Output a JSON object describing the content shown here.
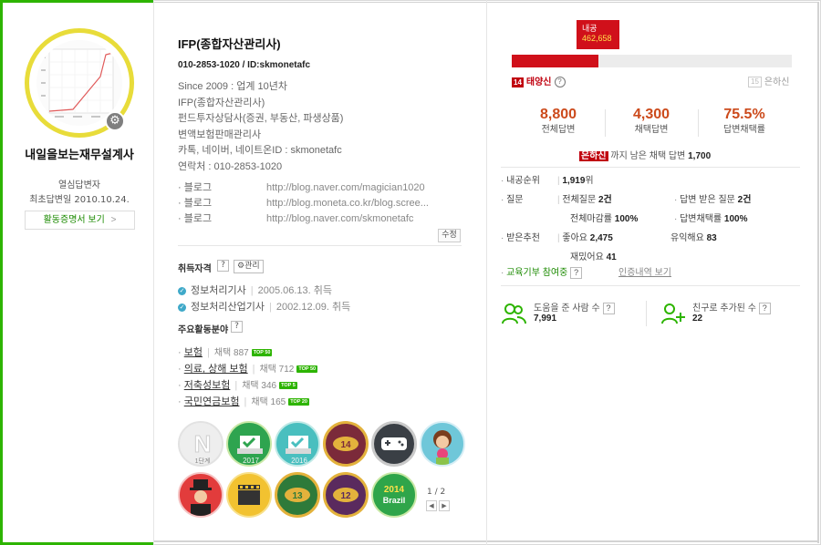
{
  "profile": {
    "nickname": "내일을보는재무설계사",
    "rank": "열심답변자",
    "first_answer": "최초답변일 2010.10.24.",
    "activity_button": "활동증명서 보기",
    "activity_arrow": ">"
  },
  "intro": {
    "title": "IFP(종합자산관리사)",
    "phone_id": "010-2853-1020 / ID:skmonetafc",
    "lines": [
      "Since 2009 : 업계 10년차",
      "IFP(종합자산관리사)",
      "펀드투자상담사(증권, 부동산, 파생상품)",
      "변액보험판매관리사",
      "카톡, 네이버, 네이트온ID : skmonetafc",
      "연락처 : 010-2853-1020"
    ]
  },
  "blogs": [
    {
      "label": "· 블로그",
      "url": "http://blog.naver.com/magician1020"
    },
    {
      "label": "· 블로그",
      "url": "http://blog.moneta.co.kr/blog.scree..."
    },
    {
      "label": "· 블로그",
      "url": "http://blog.naver.com/skmonetafc"
    }
  ],
  "edit_label": "수정",
  "certificates": {
    "heading": "취득자격",
    "help": "?",
    "manage_label": "⚙관리",
    "items": [
      {
        "name": "정보처리기사",
        "date": "2005.06.13. 취득"
      },
      {
        "name": "정보처리산업기사",
        "date": "2002.12.09. 취득"
      }
    ]
  },
  "fields": {
    "heading": "주요활동분야",
    "help": "?",
    "items": [
      {
        "name": "보험",
        "count": "채택 887",
        "badge": "TOP 50"
      },
      {
        "name": "의료, 상해 보험",
        "count": "채택 712",
        "badge": "TOP 50"
      },
      {
        "name": "저축성보험",
        "count": "채택 346",
        "badge": "TOP 5"
      },
      {
        "name": "국민연금보험",
        "count": "채택 165",
        "badge": "TOP 20"
      }
    ]
  },
  "badges": {
    "items": [
      {
        "name": "1단계 N"
      },
      {
        "name": "2017"
      },
      {
        "name": "2016"
      },
      {
        "name": "14"
      },
      {
        "name": "game"
      },
      {
        "name": "rose"
      },
      {
        "name": "gentleman"
      },
      {
        "name": "movie"
      },
      {
        "name": "13"
      },
      {
        "name": "12"
      },
      {
        "name": "2014 Brazil"
      }
    ],
    "label_1": "1단계",
    "label_2017": "2017",
    "label_2016": "2016",
    "label_14": "14",
    "label_13": "13",
    "label_12": "12",
    "label_brazil_year": "2014",
    "label_brazil": "Brazil",
    "pager": "1 / 2",
    "prev": "◀",
    "next": "▶"
  },
  "level": {
    "naegong_label": "내공",
    "naegong_value": "462,658",
    "progress_fraction": 0.31,
    "current_num": "14",
    "current_name": "태양신",
    "help": "?",
    "next_num": "15",
    "next_name": "은하신",
    "remain_level": "은하신",
    "remain_text": " 까지 남은 채택 답변 ",
    "remain_count": "1,700"
  },
  "stats": [
    {
      "value": "8,800",
      "label": "전체답변"
    },
    {
      "value": "4,300",
      "label": "채택답변"
    },
    {
      "value": "75.5%",
      "label": "답변채택률"
    }
  ],
  "info": {
    "rank_label": "내공순위",
    "rank_value": "1,919",
    "rank_unit": "위",
    "question_label": "질문",
    "total_q_label": "전체질문",
    "total_q_value": "2건",
    "received_q_label": "답변 받은 질문",
    "received_q_value": "2건",
    "closing_label": "전체마감률",
    "closing_value": "100%",
    "adoption_label": "답변채택률",
    "adoption_value": "100%",
    "rec_label": "받은추천",
    "like_label": "좋아요",
    "like_value": "2,475",
    "useful_label": "유익해요",
    "useful_value": "83",
    "fun_label": "재밌어요",
    "fun_value": "41",
    "donation_label": "교육기부 참여중",
    "donation_help": "?",
    "cert_link": "인증내역 보기"
  },
  "friends": {
    "helped_label": "도움을 준 사람 수",
    "helped_value": "7,991",
    "added_label": "친구로 추가된 수",
    "added_value": "22",
    "help": "?"
  },
  "colors": {
    "brand_green": "#2db400",
    "level_red": "#d0101a",
    "stat_orange": "#cc4a1b",
    "avatar_ring": "#e8dc3a"
  }
}
